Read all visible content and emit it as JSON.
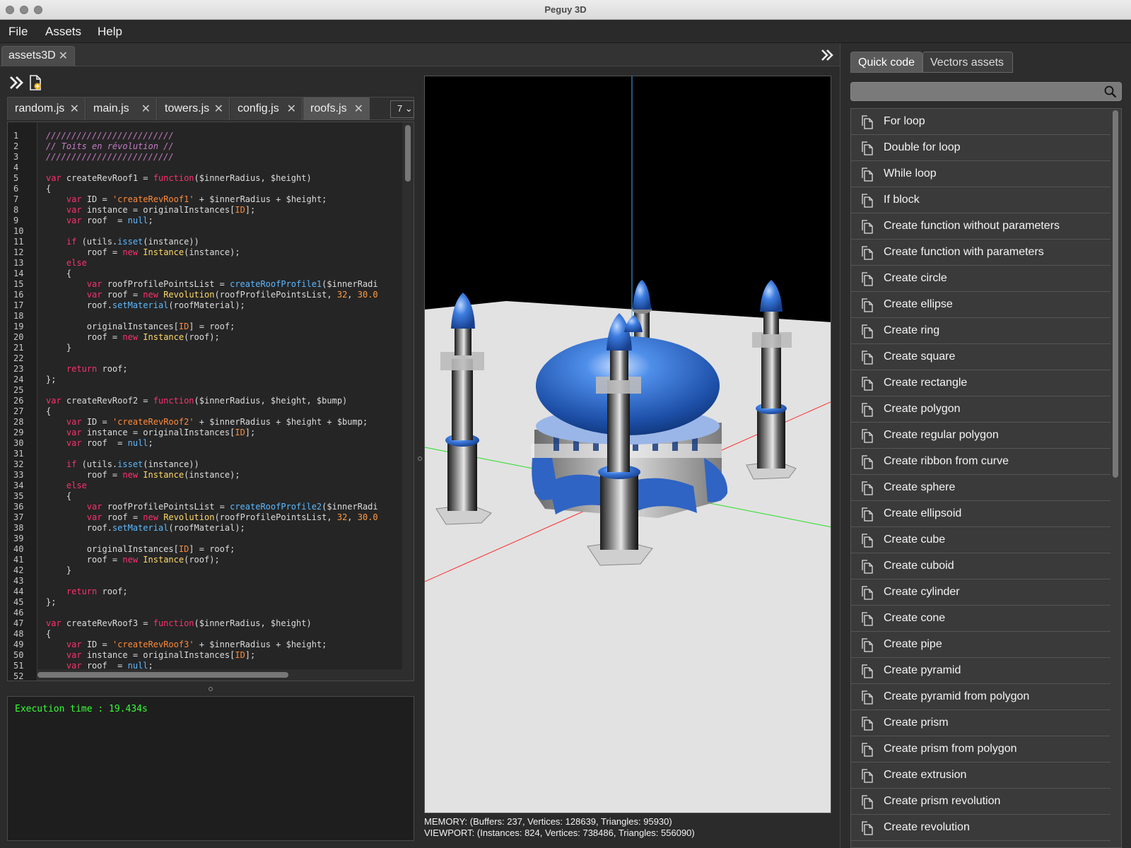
{
  "window": {
    "title": "Peguy 3D"
  },
  "menu": [
    "File",
    "Assets",
    "Help"
  ],
  "project_tab": {
    "label": "assets3D",
    "close": "✕"
  },
  "editor_tabs": [
    {
      "label": "random.js",
      "close": "✕"
    },
    {
      "label": "main.js",
      "close": "✕"
    },
    {
      "label": "towers.js",
      "close": "✕"
    },
    {
      "label": "config.js",
      "close": "✕"
    },
    {
      "label": "roofs.js",
      "close": "✕",
      "active": true
    }
  ],
  "editor_more": {
    "label": "7 ⌄"
  },
  "code": [
    "/////////////////////////",
    "// Toits en révolution //",
    "/////////////////////////",
    "",
    "var createRevRoof1 = function($innerRadius, $height)",
    "{",
    "    var ID = 'createRevRoof1' + $innerRadius + $height;",
    "    var instance = originalInstances[ID];",
    "    var roof  = null;",
    "",
    "    if (utils.isset(instance))",
    "        roof = new Instance(instance);",
    "    else",
    "    {",
    "        var roofProfilePointsList = createRoofProfile1($innerRadi",
    "        var roof = new Revolution(roofProfilePointsList, 32, 30.0",
    "        roof.setMaterial(roofMaterial);",
    "",
    "        originalInstances[ID] = roof;",
    "        roof = new Instance(roof);",
    "    }",
    "",
    "    return roof;",
    "};",
    "",
    "var createRevRoof2 = function($innerRadius, $height, $bump)",
    "{",
    "    var ID = 'createRevRoof2' + $innerRadius + $height + $bump;",
    "    var instance = originalInstances[ID];",
    "    var roof  = null;",
    "",
    "    if (utils.isset(instance))",
    "        roof = new Instance(instance);",
    "    else",
    "    {",
    "        var roofProfilePointsList = createRoofProfile2($innerRadi",
    "        var roof = new Revolution(roofProfilePointsList, 32, 30.0",
    "        roof.setMaterial(roofMaterial);",
    "",
    "        originalInstances[ID] = roof;",
    "        roof = new Instance(roof);",
    "    }",
    "",
    "    return roof;",
    "};",
    "",
    "var createRevRoof3 = function($innerRadius, $height)",
    "{",
    "    var ID = 'createRevRoof3' + $innerRadius + $height;",
    "    var instance = originalInstances[ID];",
    "    var roof  = null;",
    ""
  ],
  "console": {
    "output": "Execution time : 19.434s"
  },
  "stats": {
    "memory": "MEMORY: (Buffers: 237, Vertices: 128639, Triangles: 95930)",
    "viewport": "VIEWPORT: (Instances: 824, Vertices: 738486, Triangles: 556090)"
  },
  "right_tabs": [
    "Quick code",
    "Vectors assets"
  ],
  "search": {
    "value": "",
    "placeholder": ""
  },
  "quick_code": [
    "For loop",
    "Double for loop",
    "While loop",
    "If block",
    "Create function without parameters",
    "Create function with parameters",
    "Create circle",
    "Create ellipse",
    "Create ring",
    "Create square",
    "Create rectangle",
    "Create polygon",
    "Create regular polygon",
    "Create ribbon from curve",
    "Create sphere",
    "Create ellipsoid",
    "Create cube",
    "Create cuboid",
    "Create cylinder",
    "Create cone",
    "Create pipe",
    "Create pyramid",
    "Create pyramid from polygon",
    "Create prism",
    "Create prism from polygon",
    "Create extrusion",
    "Create prism revolution",
    "Create revolution"
  ],
  "colors": {
    "keyword": "#ff2f6e",
    "string": "#ff8a3a",
    "function": "#5cb8ff",
    "class": "#ffd86a",
    "comment": "#c67cc6",
    "console_text": "#36ff36",
    "dome_blue": "#2f6fd0"
  },
  "icons": {
    "collapse": "double-chevron-right-icon",
    "new_file": "new-file-icon",
    "search": "magnifier-icon",
    "snippet": "copy-document-icon"
  }
}
